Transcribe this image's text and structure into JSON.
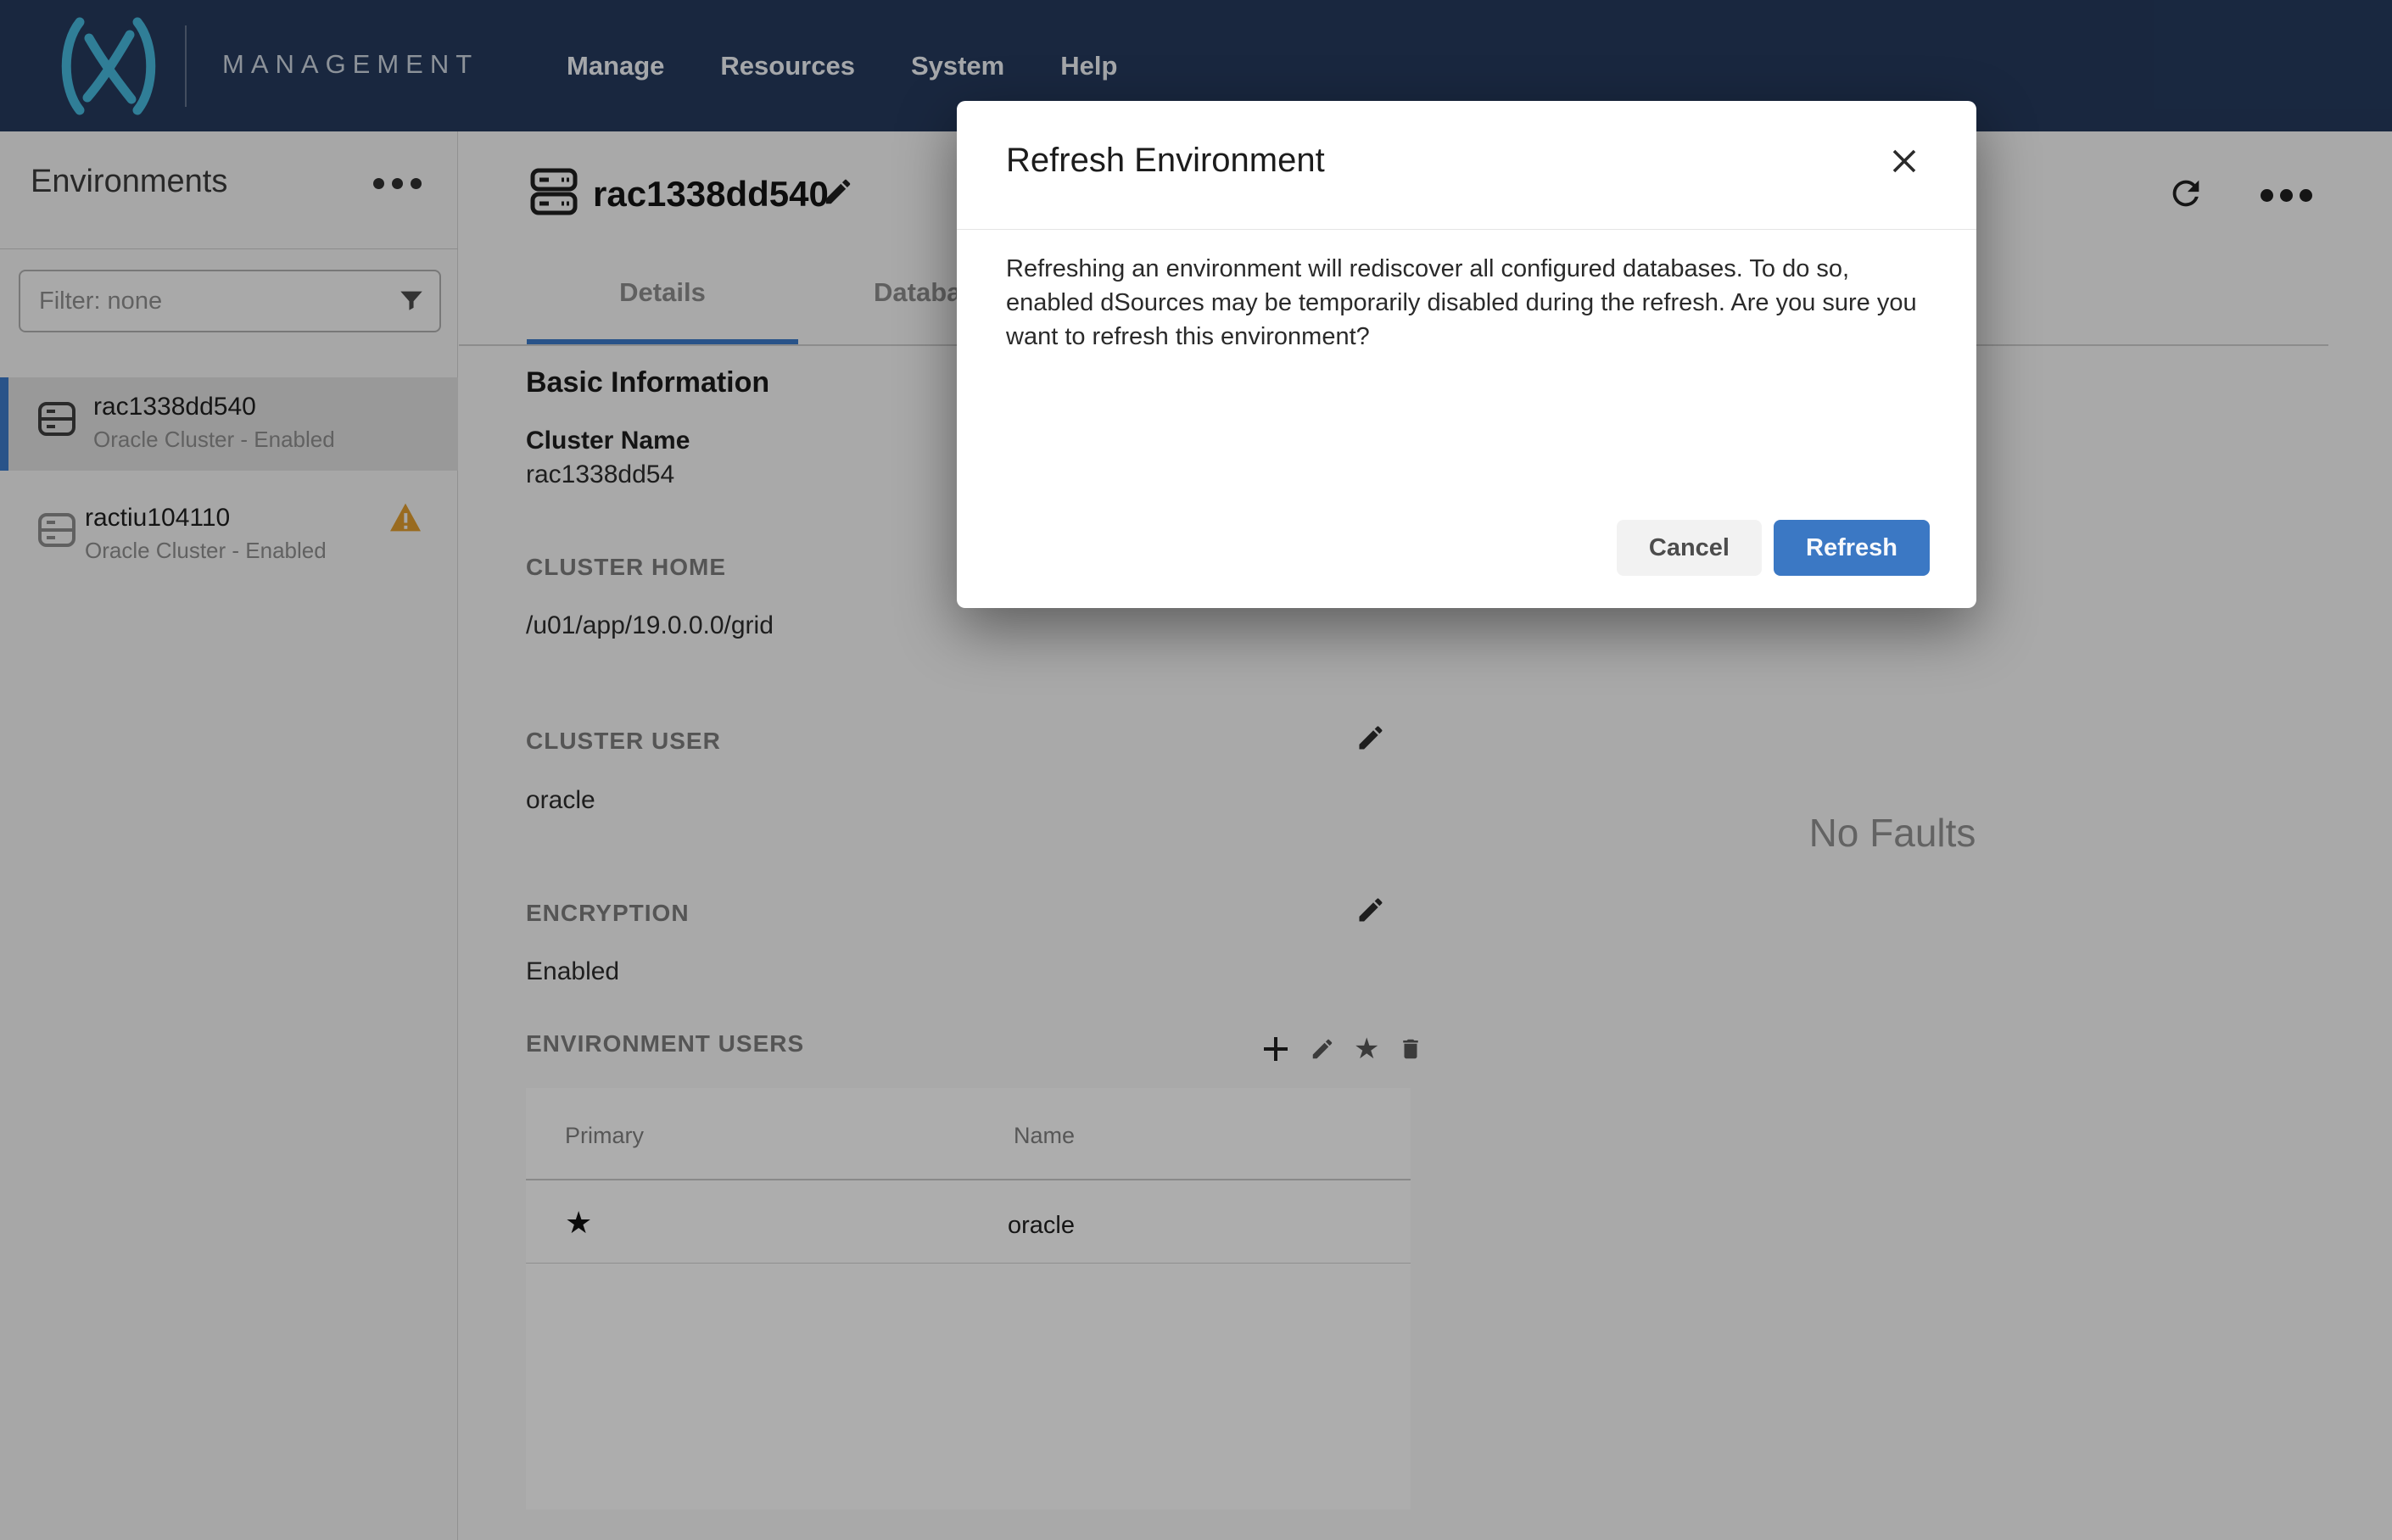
{
  "nav": {
    "brand": "MANAGEMENT",
    "items": [
      {
        "label": "Manage"
      },
      {
        "label": "Resources"
      },
      {
        "label": "System"
      },
      {
        "label": "Help"
      }
    ]
  },
  "sidebar": {
    "title": "Environments",
    "filter_placeholder": "Filter: none",
    "items": [
      {
        "name": "rac1338dd540",
        "subtitle": "Oracle Cluster - Enabled",
        "selected": true,
        "warning": false
      },
      {
        "name": "ractiu104110",
        "subtitle": "Oracle Cluster - Enabled",
        "selected": false,
        "warning": true
      }
    ]
  },
  "main": {
    "title": "rac1338dd540",
    "tabs": [
      {
        "label": "Details",
        "active": true
      },
      {
        "label": "Databases",
        "active": false
      }
    ],
    "basic_information": {
      "heading": "Basic Information",
      "cluster_name_label": "Cluster Name",
      "cluster_name_value": "rac1338dd54",
      "cluster_home_label": "CLUSTER HOME",
      "cluster_home_value": "/u01/app/19.0.0.0/grid"
    },
    "cluster_user": {
      "label": "CLUSTER USER",
      "value": "oracle"
    },
    "encryption": {
      "label": "ENCRYPTION",
      "value": "Enabled"
    },
    "environment_users": {
      "label": "ENVIRONMENT USERS",
      "columns": [
        "Primary",
        "Name"
      ],
      "rows": [
        {
          "primary": true,
          "primary_icon": "★",
          "name": "oracle"
        }
      ]
    },
    "faults": {
      "empty_text": "No Faults"
    }
  },
  "modal": {
    "title": "Refresh Environment",
    "body": "Refreshing an environment will rediscover all configured databases. To do so, enabled dSources may be temporarily disabled during the refresh. Are you sure you want to refresh this environment?",
    "cancel_label": "Cancel",
    "confirm_label": "Refresh"
  },
  "icons": {
    "logo": "delphix-x-mark",
    "environment": "server",
    "filter": "funnel",
    "warning": "triangle-exclamation",
    "edit": "pencil",
    "add": "plus",
    "primary": "star",
    "delete": "trash",
    "refresh": "circular-arrow",
    "more": "horizontal-ellipsis",
    "close": "x"
  },
  "colors": {
    "nav_navy": "#24395B",
    "logo_teal": "#45B5D9",
    "accent_blue": "#3B78C4",
    "warning_amber": "#DC9A2E",
    "dim_overlay": "rgba(0,0,0,0.30)"
  }
}
